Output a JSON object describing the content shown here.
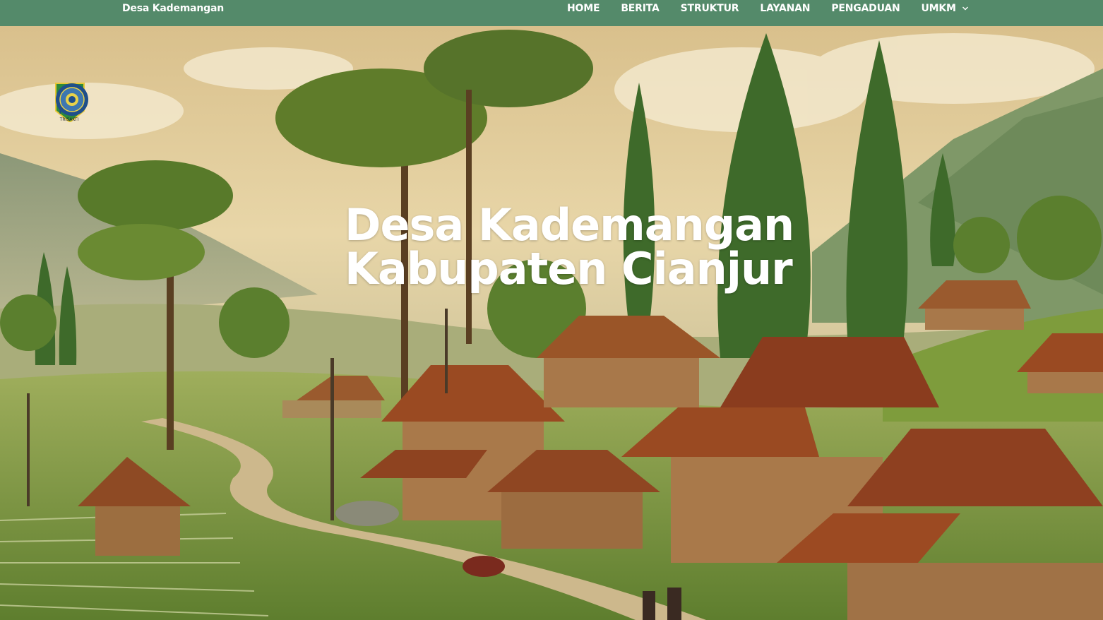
{
  "navbar": {
    "brand": "Desa Kademangan",
    "items": [
      {
        "label": "HOME"
      },
      {
        "label": "BERITA"
      },
      {
        "label": "STRUKTUR"
      },
      {
        "label": "LAYANAN"
      },
      {
        "label": "PENGADUAN"
      },
      {
        "label": "UMKM",
        "has_dropdown": true
      }
    ]
  },
  "logos": {
    "itl_lettering": "ITL",
    "itl_sub": "TRISAKTI"
  },
  "hero": {
    "title_line1": "Desa Kademangan",
    "title_line2": "Kabupaten Cianjur"
  },
  "colors": {
    "navbar_bg": "#548a6a",
    "text": "#ffffff"
  }
}
